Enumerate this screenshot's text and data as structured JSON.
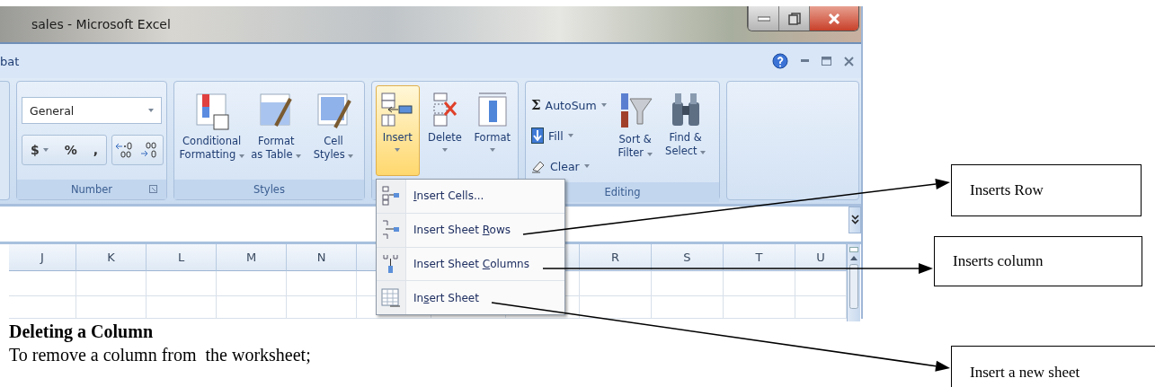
{
  "window": {
    "title": "sales - Microsoft Excel"
  },
  "ribbon_tab": {
    "label": "bat"
  },
  "number_group": {
    "label": "Number",
    "format": "General",
    "symbols": [
      "$",
      "%",
      ","
    ]
  },
  "styles_group": {
    "label": "Styles",
    "buttons": [
      {
        "lines": [
          "Conditional",
          "Formatting"
        ]
      },
      {
        "lines": [
          "Format",
          "as Table"
        ]
      },
      {
        "lines": [
          "Cell",
          "Styles"
        ]
      }
    ]
  },
  "cells_group": {
    "buttons": [
      {
        "label": "Insert",
        "kind": "insert",
        "selected": true
      },
      {
        "label": "Delete",
        "kind": "delete",
        "selected": false
      },
      {
        "label": "Format",
        "kind": "format",
        "selected": false
      }
    ]
  },
  "editing_group": {
    "label": "Editing",
    "small": [
      {
        "label": "AutoSum",
        "icon": "Σ",
        "kind": "sum"
      },
      {
        "label": "Fill",
        "kind": "fill"
      },
      {
        "label": "Clear",
        "kind": "clear"
      }
    ],
    "large": [
      {
        "lines": [
          "Sort &",
          "Filter"
        ],
        "kind": "sort"
      },
      {
        "lines": [
          "Find &",
          "Select"
        ],
        "kind": "find"
      }
    ]
  },
  "columns_left": [
    "J",
    "K",
    "L",
    "M",
    "N"
  ],
  "columns_right": [
    "R",
    "S",
    "T",
    "U"
  ],
  "insert_menu": [
    {
      "kind": "cells",
      "accel": "I",
      "after": "nsert Cells..."
    },
    {
      "kind": "rows",
      "before": "Insert Sheet ",
      "accel": "R",
      "after": "ows"
    },
    {
      "kind": "columns",
      "before": "Insert Sheet ",
      "accel": "C",
      "after": "olumns"
    },
    {
      "kind": "sheet",
      "before": "In",
      "accel": "s",
      "after": "ert Sheet"
    }
  ],
  "callouts": [
    {
      "text": "Inserts Row"
    },
    {
      "text": "Inserts column"
    },
    {
      "text": "Insert a new sheet"
    }
  ],
  "document": {
    "heading": "Deleting a Column",
    "paragraph": "To remove a column from  the worksheet;"
  }
}
